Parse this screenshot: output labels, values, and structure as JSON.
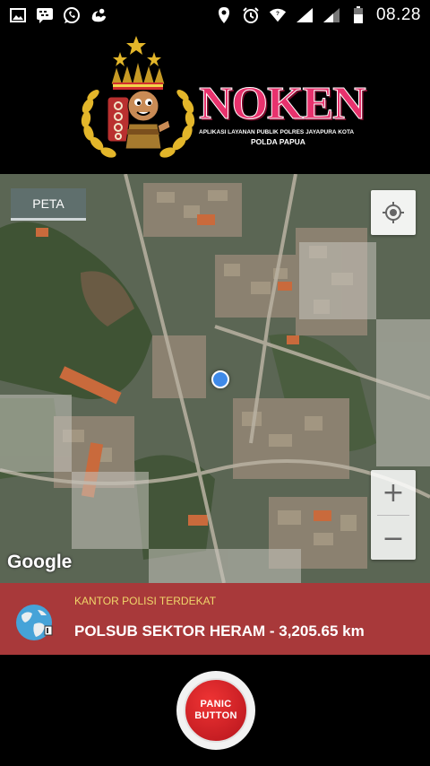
{
  "status_bar": {
    "left_icons": [
      "image-icon",
      "bbm-icon",
      "whatsapp-icon",
      "uc-browser-icon"
    ],
    "right_icons": [
      "location-icon",
      "alarm-icon",
      "wifi-icon",
      "signal-icon",
      "signal-icon-2",
      "battery-icon"
    ],
    "time": "08.28"
  },
  "header": {
    "brand_title": "NOKEN",
    "brand_subtitle": "APLIKASI LAYANAN PUBLIK POLRES JAYAPURA KOTA",
    "brand_subtitle2": "POLDA PAPUA",
    "colors": {
      "title": "#e8326d",
      "emblem_gold": "#e3b62a"
    }
  },
  "map": {
    "tab_label": "PETA",
    "zoom_in": "+",
    "zoom_out": "−",
    "logo": "Google"
  },
  "info_bar": {
    "label": "KANTOR POLISI TERDEKAT",
    "value": "POLSUB SEKTOR HERAM - 3,205.65 km",
    "colors": {
      "background": "#a8393a",
      "label": "#f0d66a"
    }
  },
  "panic": {
    "line1": "PANIC",
    "line2": "BUTTON",
    "color": "#c9171d"
  }
}
